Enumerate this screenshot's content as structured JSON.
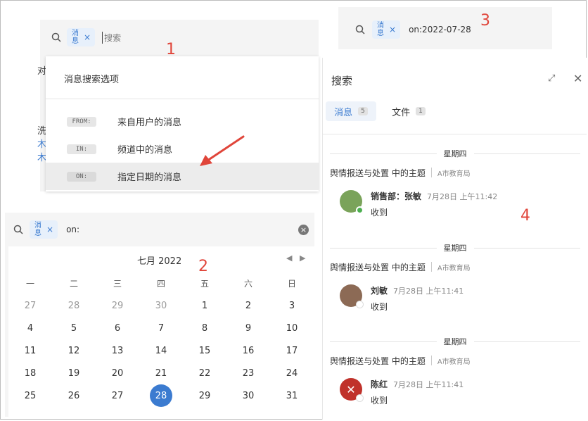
{
  "panel1": {
    "tag": {
      "label": "消息",
      "close": "×"
    },
    "placeholder": "搜索",
    "edge_chars": [
      "对",
      "洗",
      "木",
      "木"
    ],
    "options_title": "消息搜索选项",
    "options": [
      {
        "chip": "FROM:",
        "label": "来自用户的消息"
      },
      {
        "chip": "IN:",
        "label": "频道中的消息"
      },
      {
        "chip": "ON:",
        "label": "指定日期的消息"
      }
    ],
    "marker": "1"
  },
  "panel2": {
    "tag": {
      "label": "消息",
      "close": "×"
    },
    "query": "on:",
    "month_title": "七月 2022",
    "weekdays": [
      "一",
      "二",
      "三",
      "四",
      "五",
      "六",
      "日"
    ],
    "weeks": [
      [
        "27",
        "28",
        "29",
        "30",
        "1",
        "2",
        "3"
      ],
      [
        "4",
        "5",
        "6",
        "7",
        "8",
        "9",
        "10"
      ],
      [
        "11",
        "12",
        "13",
        "14",
        "15",
        "16",
        "17"
      ],
      [
        "18",
        "19",
        "20",
        "21",
        "22",
        "23",
        "24"
      ],
      [
        "25",
        "26",
        "27",
        "28",
        "29",
        "30",
        "31"
      ]
    ],
    "selected_day": "28",
    "marker": "2"
  },
  "panel3": {
    "tag": {
      "label": "消息",
      "close": "×"
    },
    "query": "on:2022-07-28",
    "marker": "3"
  },
  "panel4": {
    "title": "搜索",
    "tabs": [
      {
        "label": "消息",
        "count": "5",
        "active": true
      },
      {
        "label": "文件",
        "count": "1",
        "active": false
      }
    ],
    "groups": [
      {
        "day": "星期四",
        "topic": "舆情报送与处置 中的主题",
        "channel": "A市教育局",
        "sender": "销售部：张敏",
        "time": "7月28日 上午11:42",
        "text": "收到",
        "avatar_color": "#7aa35a",
        "online": true
      },
      {
        "day": "星期四",
        "topic": "舆情报送与处置 中的主题",
        "channel": "A市教育局",
        "sender": "刘敏",
        "time": "7月28日 上午11:41",
        "text": "收到",
        "avatar_color": "#8c6a55",
        "online": false
      },
      {
        "day": "星期四",
        "topic": "舆情报送与处置 中的主题",
        "channel": "A市教育局",
        "sender": "陈红",
        "time": "7月28日 上午11:41",
        "text": "收到",
        "avatar_color": "#c0322b",
        "avatar_glyph": "✕",
        "online": false
      }
    ],
    "marker": "4"
  },
  "colors": {
    "accent": "#3b7bd0",
    "marker": "#e0453a",
    "arrow": "#e0453a"
  }
}
